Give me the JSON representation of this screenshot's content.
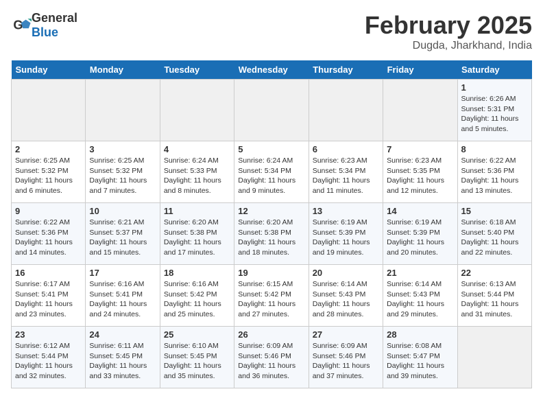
{
  "header": {
    "logo_general": "General",
    "logo_blue": "Blue",
    "month": "February 2025",
    "location": "Dugda, Jharkhand, India"
  },
  "days_of_week": [
    "Sunday",
    "Monday",
    "Tuesday",
    "Wednesday",
    "Thursday",
    "Friday",
    "Saturday"
  ],
  "weeks": [
    [
      {
        "day": "",
        "info": ""
      },
      {
        "day": "",
        "info": ""
      },
      {
        "day": "",
        "info": ""
      },
      {
        "day": "",
        "info": ""
      },
      {
        "day": "",
        "info": ""
      },
      {
        "day": "",
        "info": ""
      },
      {
        "day": "1",
        "info": "Sunrise: 6:26 AM\nSunset: 5:31 PM\nDaylight: 11 hours\nand 5 minutes."
      }
    ],
    [
      {
        "day": "2",
        "info": "Sunrise: 6:25 AM\nSunset: 5:32 PM\nDaylight: 11 hours\nand 6 minutes."
      },
      {
        "day": "3",
        "info": "Sunrise: 6:25 AM\nSunset: 5:32 PM\nDaylight: 11 hours\nand 7 minutes."
      },
      {
        "day": "4",
        "info": "Sunrise: 6:24 AM\nSunset: 5:33 PM\nDaylight: 11 hours\nand 8 minutes."
      },
      {
        "day": "5",
        "info": "Sunrise: 6:24 AM\nSunset: 5:34 PM\nDaylight: 11 hours\nand 9 minutes."
      },
      {
        "day": "6",
        "info": "Sunrise: 6:23 AM\nSunset: 5:34 PM\nDaylight: 11 hours\nand 11 minutes."
      },
      {
        "day": "7",
        "info": "Sunrise: 6:23 AM\nSunset: 5:35 PM\nDaylight: 11 hours\nand 12 minutes."
      },
      {
        "day": "8",
        "info": "Sunrise: 6:22 AM\nSunset: 5:36 PM\nDaylight: 11 hours\nand 13 minutes."
      }
    ],
    [
      {
        "day": "9",
        "info": "Sunrise: 6:22 AM\nSunset: 5:36 PM\nDaylight: 11 hours\nand 14 minutes."
      },
      {
        "day": "10",
        "info": "Sunrise: 6:21 AM\nSunset: 5:37 PM\nDaylight: 11 hours\nand 15 minutes."
      },
      {
        "day": "11",
        "info": "Sunrise: 6:20 AM\nSunset: 5:38 PM\nDaylight: 11 hours\nand 17 minutes."
      },
      {
        "day": "12",
        "info": "Sunrise: 6:20 AM\nSunset: 5:38 PM\nDaylight: 11 hours\nand 18 minutes."
      },
      {
        "day": "13",
        "info": "Sunrise: 6:19 AM\nSunset: 5:39 PM\nDaylight: 11 hours\nand 19 minutes."
      },
      {
        "day": "14",
        "info": "Sunrise: 6:19 AM\nSunset: 5:39 PM\nDaylight: 11 hours\nand 20 minutes."
      },
      {
        "day": "15",
        "info": "Sunrise: 6:18 AM\nSunset: 5:40 PM\nDaylight: 11 hours\nand 22 minutes."
      }
    ],
    [
      {
        "day": "16",
        "info": "Sunrise: 6:17 AM\nSunset: 5:41 PM\nDaylight: 11 hours\nand 23 minutes."
      },
      {
        "day": "17",
        "info": "Sunrise: 6:16 AM\nSunset: 5:41 PM\nDaylight: 11 hours\nand 24 minutes."
      },
      {
        "day": "18",
        "info": "Sunrise: 6:16 AM\nSunset: 5:42 PM\nDaylight: 11 hours\nand 25 minutes."
      },
      {
        "day": "19",
        "info": "Sunrise: 6:15 AM\nSunset: 5:42 PM\nDaylight: 11 hours\nand 27 minutes."
      },
      {
        "day": "20",
        "info": "Sunrise: 6:14 AM\nSunset: 5:43 PM\nDaylight: 11 hours\nand 28 minutes."
      },
      {
        "day": "21",
        "info": "Sunrise: 6:14 AM\nSunset: 5:43 PM\nDaylight: 11 hours\nand 29 minutes."
      },
      {
        "day": "22",
        "info": "Sunrise: 6:13 AM\nSunset: 5:44 PM\nDaylight: 11 hours\nand 31 minutes."
      }
    ],
    [
      {
        "day": "23",
        "info": "Sunrise: 6:12 AM\nSunset: 5:44 PM\nDaylight: 11 hours\nand 32 minutes."
      },
      {
        "day": "24",
        "info": "Sunrise: 6:11 AM\nSunset: 5:45 PM\nDaylight: 11 hours\nand 33 minutes."
      },
      {
        "day": "25",
        "info": "Sunrise: 6:10 AM\nSunset: 5:45 PM\nDaylight: 11 hours\nand 35 minutes."
      },
      {
        "day": "26",
        "info": "Sunrise: 6:09 AM\nSunset: 5:46 PM\nDaylight: 11 hours\nand 36 minutes."
      },
      {
        "day": "27",
        "info": "Sunrise: 6:09 AM\nSunset: 5:46 PM\nDaylight: 11 hours\nand 37 minutes."
      },
      {
        "day": "28",
        "info": "Sunrise: 6:08 AM\nSunset: 5:47 PM\nDaylight: 11 hours\nand 39 minutes."
      },
      {
        "day": "",
        "info": ""
      }
    ]
  ]
}
